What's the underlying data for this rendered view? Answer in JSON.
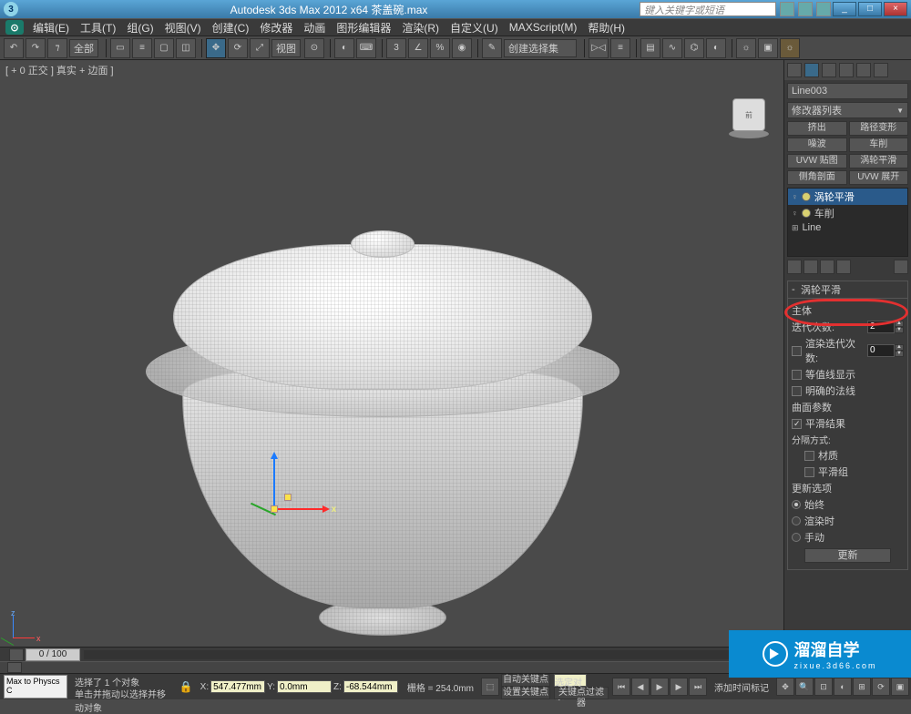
{
  "titlebar": {
    "title": "Autodesk 3ds Max 2012 x64    茶盖碗.max",
    "search_placeholder": "键入关键字或短语",
    "min": "_",
    "max": "□",
    "close": "×"
  },
  "menu": {
    "items": [
      "编辑(E)",
      "工具(T)",
      "组(G)",
      "视图(V)",
      "创建(C)",
      "修改器",
      "动画",
      "图形编辑器",
      "渲染(R)",
      "自定义(U)",
      "MAXScript(M)",
      "帮助(H)"
    ]
  },
  "toolbar": {
    "selset_combo": "全部",
    "view_combo": "视图",
    "create_combo": "创建选择集"
  },
  "viewport": {
    "label": "[ + 0 正交 ] 真实 + 边面 ]",
    "axis": {
      "x": "x",
      "y": "",
      "z": ""
    }
  },
  "panel": {
    "object_name": "Line003",
    "modifier_list": "修改器列表",
    "buttons": [
      "挤出",
      "路径变形",
      "噪波",
      "车削",
      "UVW 贴图",
      "涡轮平滑",
      "侧角剖面",
      "UVW 展开"
    ],
    "stack": [
      {
        "label": "涡轮平滑",
        "selected": true
      },
      {
        "label": "车削",
        "selected": false
      },
      {
        "label": "Line",
        "selected": false
      }
    ],
    "rollout_title": "涡轮平滑",
    "main_group": "主体",
    "iterations_label": "迭代次数:",
    "iterations_value": "2",
    "render_iters_label": "渲染迭代次数:",
    "render_iters_value": "0",
    "isoline_label": "等值线显示",
    "explicit_label": "明确的法线",
    "surface_group": "曲面参数",
    "smooth_result": "平滑结果",
    "separate_by": "分隔方式:",
    "sep_material": "材质",
    "sep_smgroup": "平滑组",
    "update_group": "更新选项",
    "upd_always": "始终",
    "upd_render": "渲染时",
    "upd_manual": "手动",
    "update_btn": "更新"
  },
  "status": {
    "script_btn": "Max to Physcs C",
    "line1": "选择了 1 个对象",
    "line2": "单击并拖动以选择并移动对象",
    "lock_icon": "🔒",
    "x_label": "X:",
    "x_val": "547.477mm",
    "y_label": "Y:",
    "y_val": "0.0mm",
    "z_label": "Z:",
    "z_val": "-68.544mm",
    "grid_label": "栅格 = 254.0mm",
    "timetag": "添加时间标记",
    "autokey": "自动关键点",
    "selkey": "选定对象",
    "setkey": "设置关键点",
    "keyfilter": "关键点过滤器",
    "slider": "0 / 100"
  },
  "watermark": {
    "brand": "溜溜自学",
    "url": "zixue.3d66.com"
  }
}
